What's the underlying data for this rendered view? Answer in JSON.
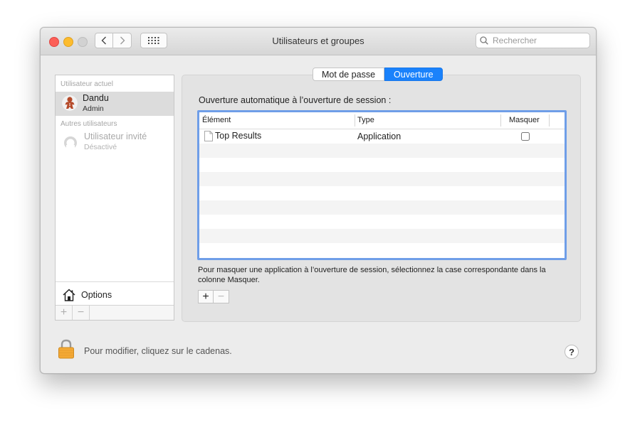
{
  "window": {
    "title": "Utilisateurs et groupes",
    "search_placeholder": "Rechercher"
  },
  "sidebar": {
    "current_user_heading": "Utilisateur actuel",
    "current_user": {
      "name": "Dandu",
      "role": "Admin"
    },
    "other_users_heading": "Autres utilisateurs",
    "guest_user": {
      "name": "Utilisateur invité",
      "status": "Désactivé"
    },
    "options_label": "Options",
    "add_label": "+",
    "remove_label": "−"
  },
  "tabs": [
    {
      "label": "Mot de passe",
      "active": false
    },
    {
      "label": "Ouverture",
      "active": true
    }
  ],
  "login_items": {
    "heading": "Ouverture automatique à l’ouverture de session :",
    "columns": [
      "Élément",
      "Type",
      "Masquer"
    ],
    "rows": [
      {
        "item": "Top Results",
        "type": "Application",
        "hide": false
      }
    ],
    "hint": "Pour masquer une application à l’ouverture de session, sélectionnez la case correspondante dans la colonne Masquer.",
    "add_label": "+",
    "remove_label": "−"
  },
  "footer": {
    "lock_text": "Pour modifier, cliquez sur le cadenas.",
    "help_label": "?"
  },
  "colors": {
    "accent": "#1a82fb",
    "table_focus": "#6f9ee8",
    "close": "#fc5f57",
    "minimize": "#fdbc2e",
    "lock": "#f0a93a"
  }
}
